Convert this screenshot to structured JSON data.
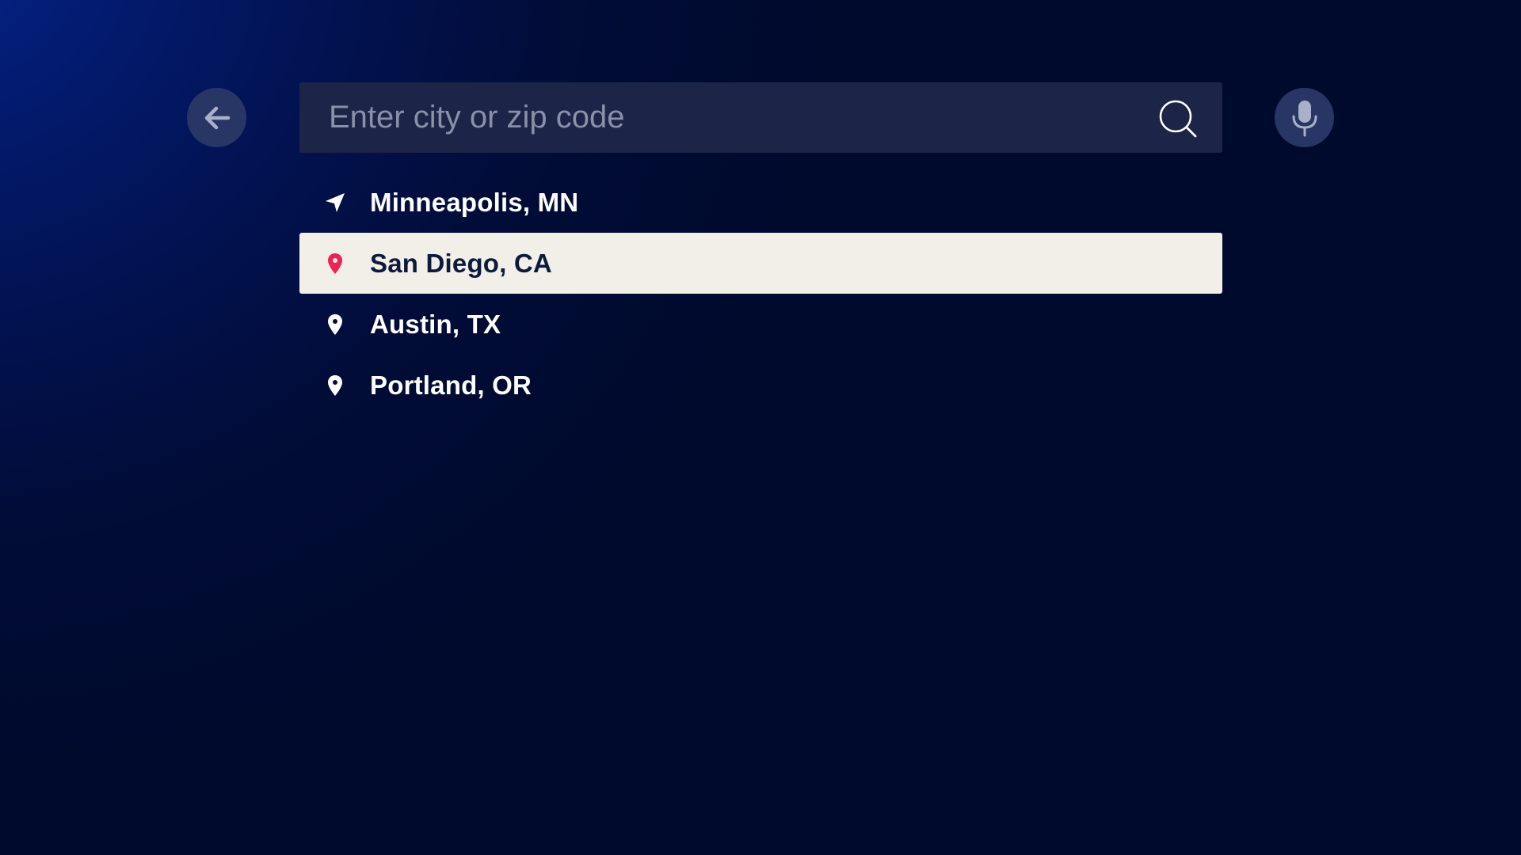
{
  "navigation": {
    "back_icon": "arrow-left-icon"
  },
  "search": {
    "placeholder": "Enter city or zip code",
    "value": "",
    "search_icon": "magnifier-icon"
  },
  "voice": {
    "mic_icon": "microphone-icon"
  },
  "suggestions": [
    {
      "label": "Minneapolis, MN",
      "icon": "location-arrow-icon",
      "selected": false
    },
    {
      "label": "San Diego, CA",
      "icon": "map-pin-icon",
      "selected": true
    },
    {
      "label": "Austin, TX",
      "icon": "map-pin-icon",
      "selected": false
    },
    {
      "label": "Portland, OR",
      "icon": "map-pin-icon",
      "selected": false
    }
  ],
  "colors": {
    "background_dark": "#000a2c",
    "background_glow": "#042488",
    "search_bar": "#1c2448",
    "round_button": "#283666",
    "selected_row": "#f1efe8",
    "selected_text": "#0e1a3c",
    "pin_accent": "#f0224f",
    "placeholder_text": "#8a90a8"
  }
}
